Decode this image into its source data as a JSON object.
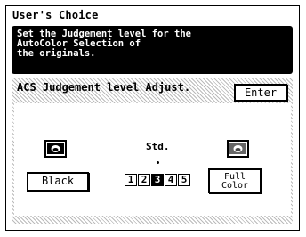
{
  "window": {
    "title": "User's Choice"
  },
  "message": "Set the Judgement level for the\nAutoColor Selection of\nthe originals.",
  "panel": {
    "title": "ACS Judgement level Adjust.",
    "enter_label": "Enter"
  },
  "slider": {
    "default_label": "Std.",
    "levels": [
      "1",
      "2",
      "3",
      "4",
      "5"
    ],
    "selected": "3",
    "left_label": "Black",
    "right_label": "Full\nColor"
  },
  "icons": {
    "left": "black-original-icon",
    "right": "full-color-original-icon"
  }
}
